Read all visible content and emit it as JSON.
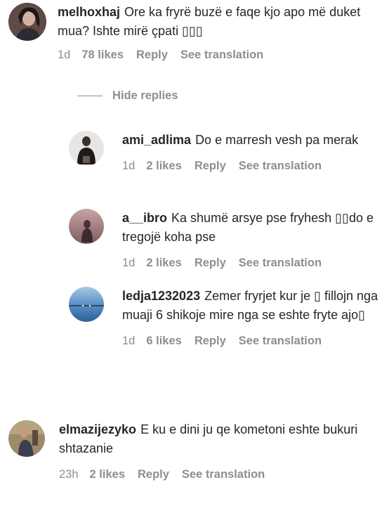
{
  "comments": [
    {
      "username": "melhoxhaj",
      "text": "Ore ka fryrë buzë e faqe kjo apo më duket mua? Ishte mirë çpati ▯▯▯",
      "time": "1d",
      "likes": "78 likes",
      "reply_label": "Reply",
      "translation_label": "See translation"
    }
  ],
  "hide_replies_label": "Hide replies",
  "replies": [
    {
      "username": "ami_adlima",
      "text": "Do e marresh vesh pa merak",
      "time": "1d",
      "likes": "2 likes",
      "reply_label": "Reply",
      "translation_label": "See translation"
    },
    {
      "username": "a__ibro",
      "text": "Ka shumë arsye pse fryhesh ▯▯do e tregojë koha pse",
      "time": "1d",
      "likes": "2 likes",
      "reply_label": "Reply",
      "translation_label": "See translation"
    },
    {
      "username": "ledja1232023",
      "text": "Zemer fryrjet kur je ▯ fillojn nga muaji 6 shikoje mire nga se eshte fryte ajo▯",
      "time": "1d",
      "likes": "6 likes",
      "reply_label": "Reply",
      "translation_label": "See translation"
    }
  ],
  "bottom_comment": {
    "username": "elmazijezyko",
    "text": "E ku e dini ju qe kometoni eshte bukuri shtazanie",
    "time": "23h",
    "likes": "2 likes",
    "reply_label": "Reply",
    "translation_label": "See translation"
  }
}
